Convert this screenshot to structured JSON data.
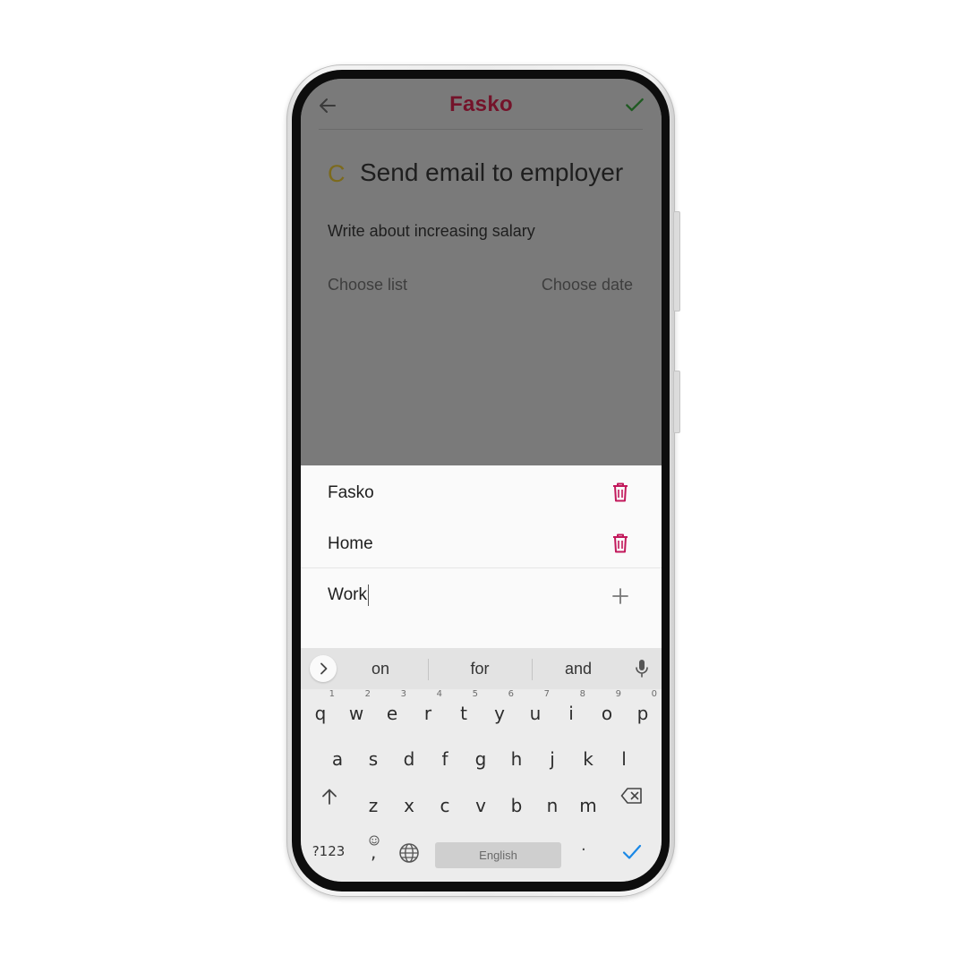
{
  "app": {
    "title": "Fasko",
    "priority_letter": "C",
    "task_title": "Send email to employer",
    "task_description": "Write about increasing salary",
    "choose_list_label": "Choose list",
    "choose_date_label": "Choose date",
    "colors": {
      "brand": "#74132a",
      "confirm": "#2e7d32",
      "delete": "#c2185b",
      "priority": "#7c6a1c"
    }
  },
  "sheet": {
    "lists": [
      {
        "label": "Fasko"
      },
      {
        "label": "Home"
      }
    ],
    "new_list_value": "Work",
    "new_list_placeholder": ""
  },
  "keyboard": {
    "suggestions": [
      "on",
      "for",
      "and"
    ],
    "row1": [
      {
        "key": "q",
        "hint": "1"
      },
      {
        "key": "w",
        "hint": "2"
      },
      {
        "key": "e",
        "hint": "3"
      },
      {
        "key": "r",
        "hint": "4"
      },
      {
        "key": "t",
        "hint": "5"
      },
      {
        "key": "y",
        "hint": "6"
      },
      {
        "key": "u",
        "hint": "7"
      },
      {
        "key": "i",
        "hint": "8"
      },
      {
        "key": "o",
        "hint": "9"
      },
      {
        "key": "p",
        "hint": "0"
      }
    ],
    "row2": [
      "a",
      "s",
      "d",
      "f",
      "g",
      "h",
      "j",
      "k",
      "l"
    ],
    "row3": [
      "z",
      "x",
      "c",
      "v",
      "b",
      "n",
      "m"
    ],
    "symbols_label": "?123",
    "comma_label": ",",
    "space_label": "English",
    "period_label": "."
  }
}
